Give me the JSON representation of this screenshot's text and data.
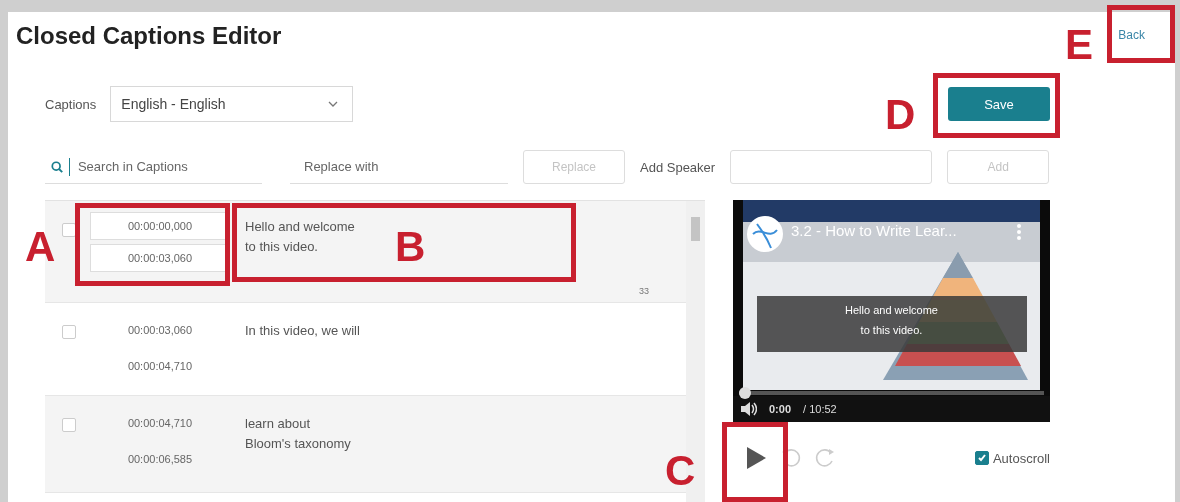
{
  "page": {
    "title": "Closed Captions Editor",
    "back_link": "Back"
  },
  "captions_select": {
    "label": "Captions",
    "value": "English - English"
  },
  "save_button": "Save",
  "search": {
    "placeholder": "Search in Captions"
  },
  "replace": {
    "placeholder": "Replace with",
    "button": "Replace",
    "disabled": true
  },
  "speaker": {
    "label": "Add Speaker",
    "button": "Add",
    "disabled": true
  },
  "captions": [
    {
      "start": "00:00:00,000",
      "end": "00:00:03,060",
      "lines": [
        "Hello and welcome",
        "to this video."
      ],
      "editing": true,
      "checked": false,
      "char_count": "33"
    },
    {
      "start": "00:00:03,060",
      "end": "00:00:04,710",
      "lines": [
        "In this video, we will"
      ],
      "editing": false,
      "checked": false
    },
    {
      "start": "00:00:04,710",
      "end": "00:00:06,585",
      "lines": [
        "learn about",
        "Bloom's taxonomy"
      ],
      "editing": false,
      "checked": false
    }
  ],
  "player": {
    "video_title": "3.2 - How to Write Lear...",
    "caption_overlay": [
      "Hello and welcome",
      "to this video."
    ],
    "current_time": "0:00",
    "duration": "/ 10:52",
    "level": 0
  },
  "autoscroll": {
    "label": "Autoscroll",
    "checked": true
  },
  "annotations": [
    {
      "label": "A"
    },
    {
      "label": "B"
    },
    {
      "label": "C"
    },
    {
      "label": "D"
    },
    {
      "label": "E"
    }
  ]
}
